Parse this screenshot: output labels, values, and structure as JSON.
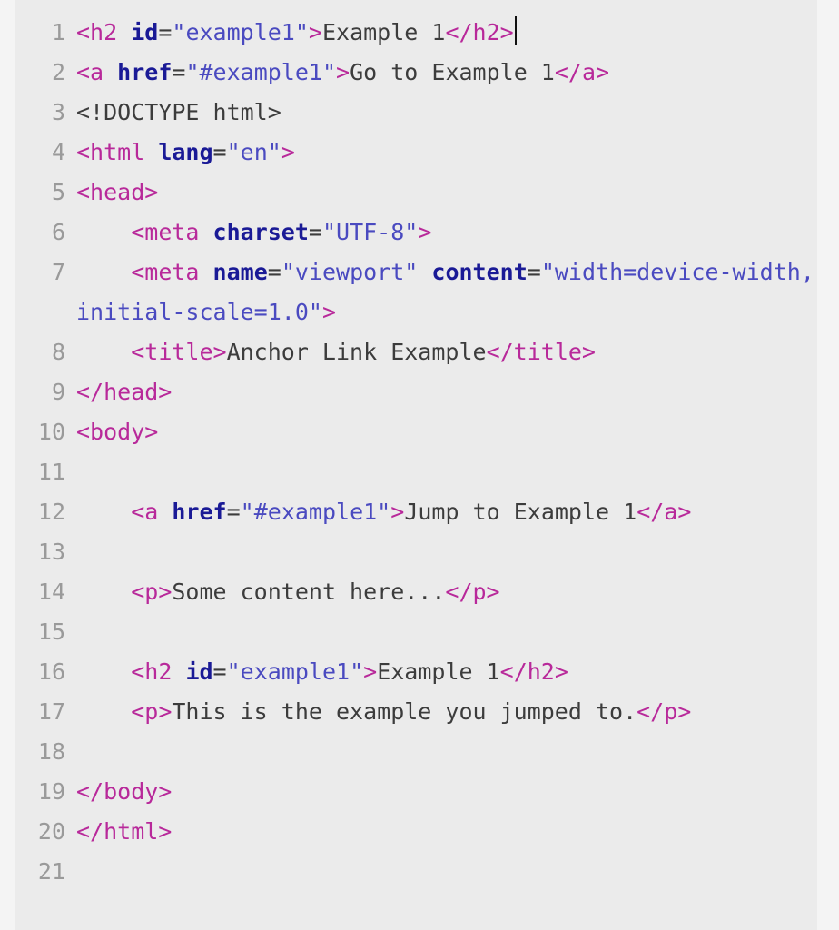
{
  "editor": {
    "language": "html",
    "background_color": "#ebebeb",
    "page_background_color": "#f4f4f4",
    "gutter_text_color": "#9a9a9a",
    "colors": {
      "tag": "#b8299a",
      "attribute_name": "#1a1a96",
      "attribute_value": "#4a4ac0",
      "text": "#3c3c3c",
      "caret": "#111111"
    },
    "caret": {
      "visible": true,
      "line": 1,
      "after_text": "</h2>"
    },
    "lines": [
      {
        "number": "1",
        "indent": "",
        "tokens": [
          {
            "type": "tag",
            "text": "<h2"
          },
          {
            "type": "text",
            "text": " "
          },
          {
            "type": "attr",
            "text": "id"
          },
          {
            "type": "punct",
            "text": "="
          },
          {
            "type": "val",
            "text": "\"example1\""
          },
          {
            "type": "tag",
            "text": ">"
          },
          {
            "type": "text",
            "text": "Example 1"
          },
          {
            "type": "tag",
            "text": "</h2>"
          }
        ],
        "caret": true
      },
      {
        "number": "2",
        "indent": "",
        "tokens": [
          {
            "type": "tag",
            "text": "<a"
          },
          {
            "type": "text",
            "text": " "
          },
          {
            "type": "attr",
            "text": "href"
          },
          {
            "type": "punct",
            "text": "="
          },
          {
            "type": "val",
            "text": "\"#example1\""
          },
          {
            "type": "tag",
            "text": ">"
          },
          {
            "type": "text",
            "text": "Go to Example 1"
          },
          {
            "type": "tag",
            "text": "</a>"
          }
        ],
        "caret": false
      },
      {
        "number": "3",
        "indent": "",
        "tokens": [
          {
            "type": "doctype",
            "text": "<!DOCTYPE html>"
          }
        ],
        "caret": false
      },
      {
        "number": "4",
        "indent": "",
        "tokens": [
          {
            "type": "tag",
            "text": "<html"
          },
          {
            "type": "text",
            "text": " "
          },
          {
            "type": "attr",
            "text": "lang"
          },
          {
            "type": "punct",
            "text": "="
          },
          {
            "type": "val",
            "text": "\"en\""
          },
          {
            "type": "tag",
            "text": ">"
          }
        ],
        "caret": false
      },
      {
        "number": "5",
        "indent": "",
        "tokens": [
          {
            "type": "tag",
            "text": "<head>"
          }
        ],
        "caret": false
      },
      {
        "number": "6",
        "indent": "    ",
        "tokens": [
          {
            "type": "tag",
            "text": "<meta"
          },
          {
            "type": "text",
            "text": " "
          },
          {
            "type": "attr",
            "text": "charset"
          },
          {
            "type": "punct",
            "text": "="
          },
          {
            "type": "val",
            "text": "\"UTF-8\""
          },
          {
            "type": "tag",
            "text": ">"
          }
        ],
        "caret": false
      },
      {
        "number": "7",
        "indent": "    ",
        "tokens": [
          {
            "type": "tag",
            "text": "<meta"
          },
          {
            "type": "text",
            "text": " "
          },
          {
            "type": "attr",
            "text": "name"
          },
          {
            "type": "punct",
            "text": "="
          },
          {
            "type": "val",
            "text": "\"viewport\""
          },
          {
            "type": "text",
            "text": " "
          },
          {
            "type": "attr",
            "text": "content"
          },
          {
            "type": "punct",
            "text": "="
          },
          {
            "type": "val",
            "text": "\"width=device-width, initial-scale=1.0\""
          },
          {
            "type": "tag",
            "text": ">"
          }
        ],
        "caret": false,
        "wrapped": true
      },
      {
        "number": "8",
        "indent": "    ",
        "tokens": [
          {
            "type": "tag",
            "text": "<title>"
          },
          {
            "type": "text",
            "text": "Anchor Link Example"
          },
          {
            "type": "tag",
            "text": "</title>"
          }
        ],
        "caret": false
      },
      {
        "number": "9",
        "indent": "",
        "tokens": [
          {
            "type": "tag",
            "text": "</head>"
          }
        ],
        "caret": false
      },
      {
        "number": "10",
        "indent": "",
        "tokens": [
          {
            "type": "tag",
            "text": "<body>"
          }
        ],
        "caret": false
      },
      {
        "number": "11",
        "indent": "",
        "tokens": [],
        "caret": false
      },
      {
        "number": "12",
        "indent": "    ",
        "tokens": [
          {
            "type": "tag",
            "text": "<a"
          },
          {
            "type": "text",
            "text": " "
          },
          {
            "type": "attr",
            "text": "href"
          },
          {
            "type": "punct",
            "text": "="
          },
          {
            "type": "val",
            "text": "\"#example1\""
          },
          {
            "type": "tag",
            "text": ">"
          },
          {
            "type": "text",
            "text": "Jump to Example 1"
          },
          {
            "type": "tag",
            "text": "</a>"
          }
        ],
        "caret": false
      },
      {
        "number": "13",
        "indent": "",
        "tokens": [],
        "caret": false
      },
      {
        "number": "14",
        "indent": "    ",
        "tokens": [
          {
            "type": "tag",
            "text": "<p>"
          },
          {
            "type": "text",
            "text": "Some content here..."
          },
          {
            "type": "tag",
            "text": "</p>"
          }
        ],
        "caret": false
      },
      {
        "number": "15",
        "indent": "",
        "tokens": [],
        "caret": false
      },
      {
        "number": "16",
        "indent": "    ",
        "tokens": [
          {
            "type": "tag",
            "text": "<h2"
          },
          {
            "type": "text",
            "text": " "
          },
          {
            "type": "attr",
            "text": "id"
          },
          {
            "type": "punct",
            "text": "="
          },
          {
            "type": "val",
            "text": "\"example1\""
          },
          {
            "type": "tag",
            "text": ">"
          },
          {
            "type": "text",
            "text": "Example 1"
          },
          {
            "type": "tag",
            "text": "</h2>"
          }
        ],
        "caret": false
      },
      {
        "number": "17",
        "indent": "    ",
        "tokens": [
          {
            "type": "tag",
            "text": "<p>"
          },
          {
            "type": "text",
            "text": "This is the example you jumped to."
          },
          {
            "type": "tag",
            "text": "</p>"
          }
        ],
        "caret": false
      },
      {
        "number": "18",
        "indent": "",
        "tokens": [],
        "caret": false
      },
      {
        "number": "19",
        "indent": "",
        "tokens": [
          {
            "type": "tag",
            "text": "</body>"
          }
        ],
        "caret": false
      },
      {
        "number": "20",
        "indent": "",
        "tokens": [
          {
            "type": "tag",
            "text": "</html>"
          }
        ],
        "caret": false
      },
      {
        "number": "21",
        "indent": "",
        "tokens": [],
        "caret": false
      }
    ]
  }
}
